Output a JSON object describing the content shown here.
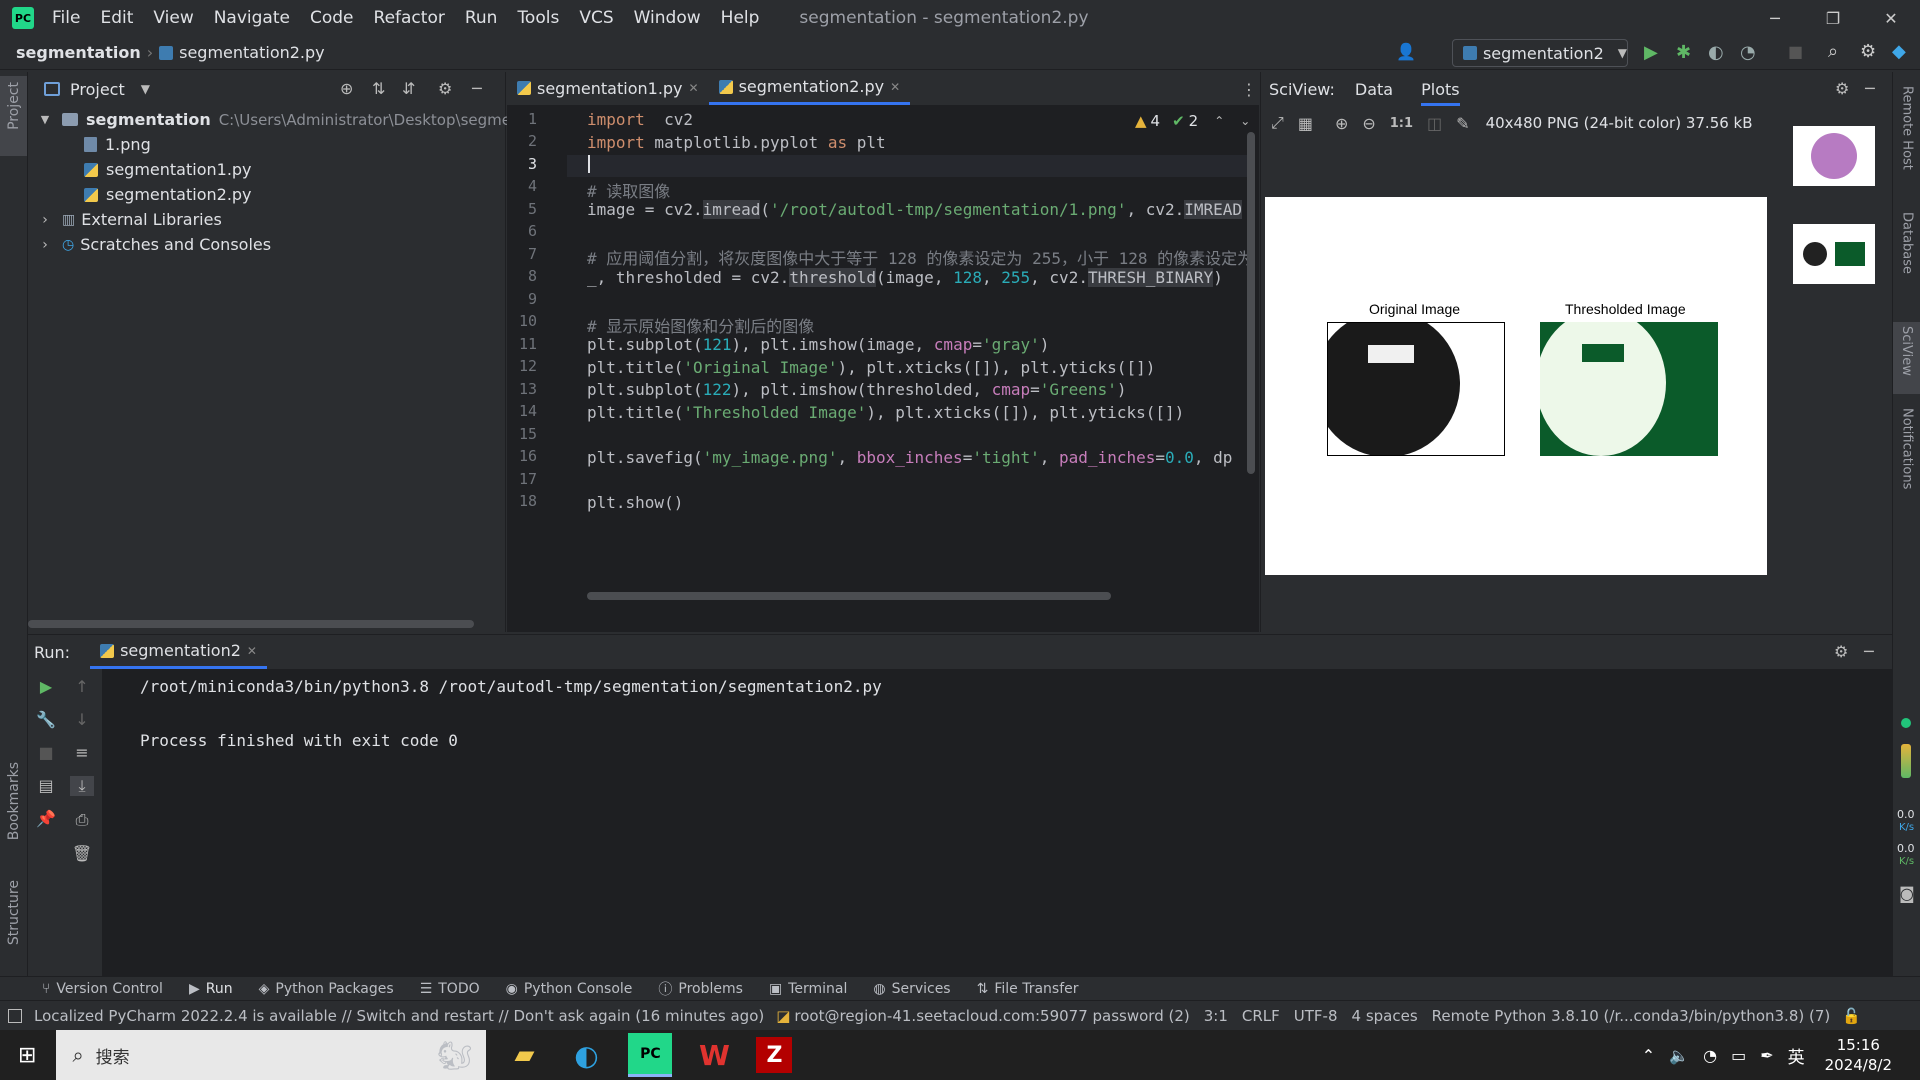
{
  "menu": [
    "File",
    "Edit",
    "View",
    "Navigate",
    "Code",
    "Refactor",
    "Run",
    "Tools",
    "VCS",
    "Window",
    "Help"
  ],
  "window_title": "segmentation - segmentation2.py",
  "breadcrumb": {
    "project": "segmentation",
    "file": "segmentation2.py"
  },
  "run_config": "segmentation2",
  "project_panel": {
    "title": "Project",
    "root": "segmentation",
    "root_path": "C:\\Users\\Administrator\\Desktop\\segmenta",
    "files": [
      "1.png",
      "segmentation1.py",
      "segmentation2.py"
    ],
    "external": "External Libraries",
    "scratches": "Scratches and Consoles"
  },
  "editor": {
    "tabs": [
      "segmentation1.py",
      "segmentation2.py"
    ],
    "warnings": "4",
    "checks": "2",
    "line_numbers": [
      "1",
      "2",
      "3",
      "4",
      "5",
      "6",
      "7",
      "8",
      "9",
      "10",
      "11",
      "12",
      "13",
      "14",
      "15",
      "16",
      "17",
      "18"
    ]
  },
  "sciview": {
    "label": "SciView:",
    "tabs": [
      "Data",
      "Plots"
    ],
    "image_info": "40x480 PNG (24-bit color) 37.56 kB",
    "zoom_label": "1:1",
    "plot_titles": [
      "Original Image",
      "Thresholded Image"
    ]
  },
  "right_stripe": [
    "Remote Host",
    "Database",
    "SciView",
    "Notifications"
  ],
  "left_stripe": [
    "Project",
    "Bookmarks",
    "Structure"
  ],
  "run": {
    "label": "Run:",
    "tab": "segmentation2",
    "command": "/root/miniconda3/bin/python3.8 /root/autodl-tmp/segmentation/segmentation2.py",
    "exit": "Process finished with exit code 0"
  },
  "net_speed": {
    "up_value": "0.0",
    "up_unit": "K/s",
    "down_value": "0.0",
    "down_unit": "K/s"
  },
  "tool_windows": [
    "Version Control",
    "Run",
    "Python Packages",
    "TODO",
    "Python Console",
    "Problems",
    "Terminal",
    "Services",
    "File Transfer"
  ],
  "status": {
    "message": "Localized PyCharm 2022.2.4 is available // Switch and restart // Don't ask again (16 minutes ago)",
    "remote": "root@region-41.seetacloud.com:59077 password (2)",
    "pos": "3:1",
    "eol": "CRLF",
    "encoding": "UTF-8",
    "indent": "4 spaces",
    "interpreter": "Remote Python 3.8.10 (/r...conda3/bin/python3.8) (7)"
  },
  "taskbar": {
    "search": "搜索",
    "ime": "英",
    "time": "15:16",
    "date": "2024/8/2"
  },
  "accent": "#3574f0"
}
